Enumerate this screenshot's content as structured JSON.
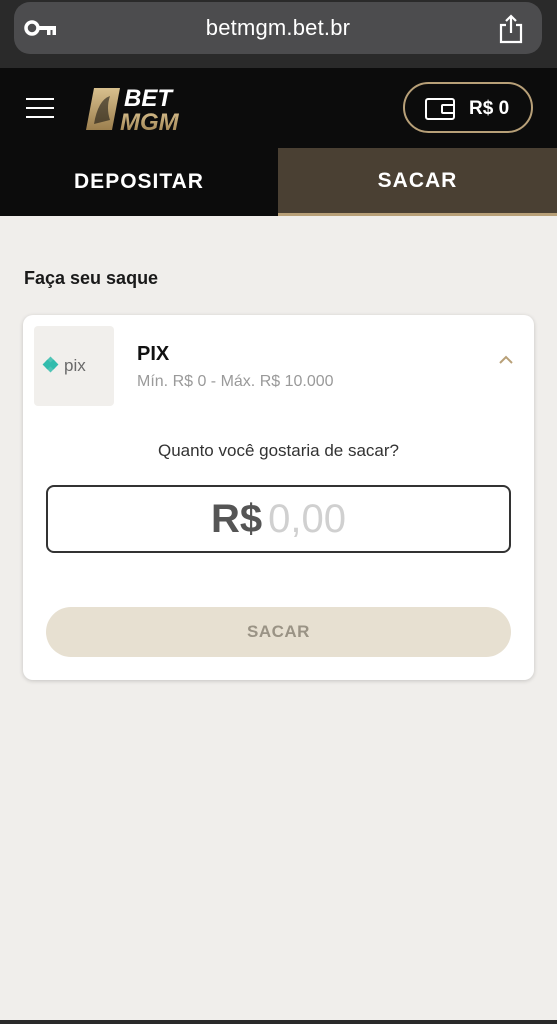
{
  "browser": {
    "url": "betmgm.bet.br"
  },
  "header": {
    "logo_top": "BET",
    "logo_bottom": "MGM",
    "wallet_balance": "R$ 0"
  },
  "tabs": [
    {
      "label": "DEPOSITAR",
      "active": false
    },
    {
      "label": "SACAR",
      "active": true
    }
  ],
  "main": {
    "section_title": "Faça seu saque",
    "method": {
      "logo_text": "pix",
      "name": "PIX",
      "limits": "Mín. R$ 0 - Máx. R$ 10.000"
    },
    "question": "Quanto você gostaria de sacar?",
    "amount": {
      "currency": "R$",
      "placeholder": "0,00"
    },
    "submit_label": "SACAR"
  },
  "colors": {
    "accent_gold": "#b8a078",
    "header_bg": "#0c0c0c",
    "active_tab_bg": "#4a4033",
    "pix_teal": "#32bcad",
    "disabled_button_bg": "#e7e0d1"
  }
}
